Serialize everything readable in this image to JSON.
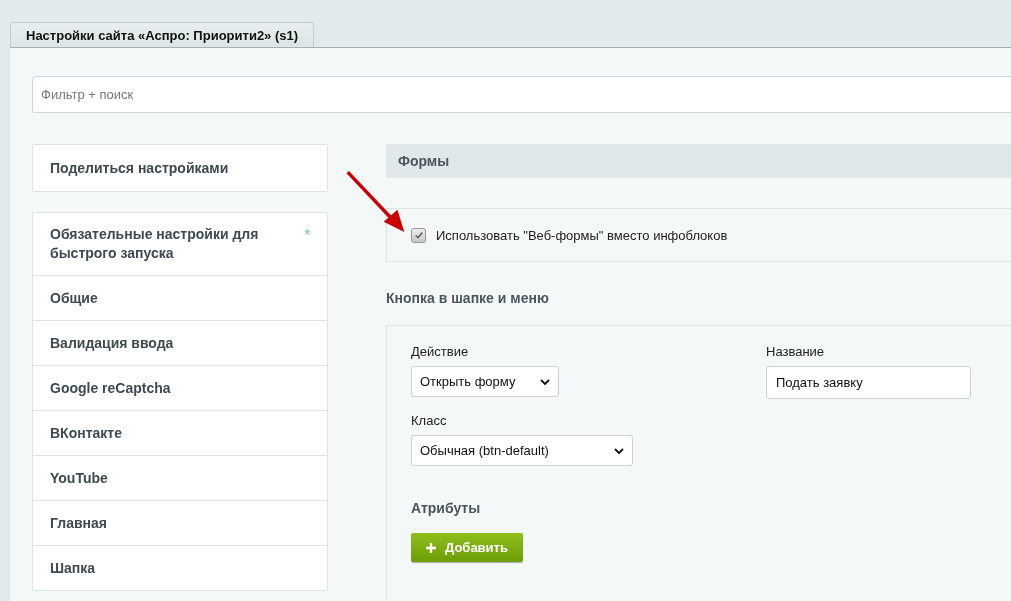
{
  "tabs": [
    {
      "label": "Настройки сайта «Аспро: Приорити2» (s1)",
      "selected": true
    }
  ],
  "filter": {
    "placeholder": "Фильтр + поиск"
  },
  "share_button": "Поделиться настройками",
  "sidebar": {
    "items": [
      {
        "label": "Обязательные настройки для быстрого запуска",
        "mark": "*"
      },
      {
        "label": "Общие"
      },
      {
        "label": "Валидация ввода"
      },
      {
        "label": "Google reCaptcha"
      },
      {
        "label": "ВКонтакте"
      },
      {
        "label": "YouTube"
      },
      {
        "label": "Главная"
      },
      {
        "label": "Шапка"
      }
    ]
  },
  "section": {
    "title": "Формы",
    "option": {
      "label": "Использовать \"Веб-формы\" вместо инфоблоков",
      "checked": true
    }
  },
  "header_button": {
    "title": "Кнопка в шапке и меню",
    "action": {
      "label": "Действие",
      "value": "Открыть форму"
    },
    "name": {
      "label": "Название",
      "value": "Подать заявку"
    },
    "class": {
      "label": "Класс",
      "value": "Обычная (btn-default)"
    },
    "attributes": {
      "title": "Атрибуты",
      "add_button": "Добавить"
    }
  }
}
